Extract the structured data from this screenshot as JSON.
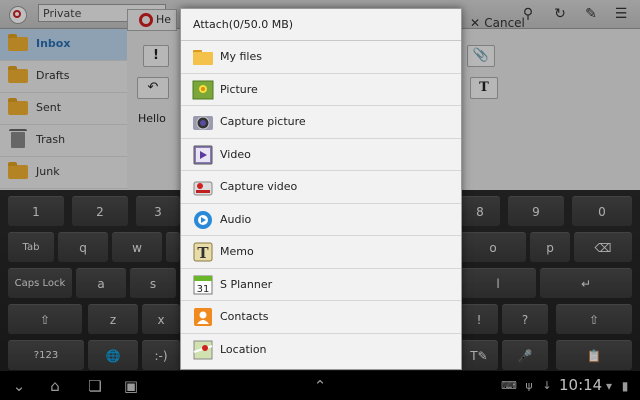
{
  "topbar": {
    "account_label": "Private",
    "compose_subject_prefix": "He",
    "cancel_label": "Cancel"
  },
  "folders": [
    {
      "label": "Inbox",
      "selected": true
    },
    {
      "label": "Drafts",
      "selected": false
    },
    {
      "label": "Sent",
      "selected": false
    },
    {
      "label": "Trash",
      "selected": false
    },
    {
      "label": "Junk",
      "selected": false
    }
  ],
  "compose": {
    "body_text": "Hello",
    "format_T": "T"
  },
  "keyboard": {
    "row1": [
      "1",
      "2",
      "3",
      "",
      "",
      "",
      "",
      "8",
      "9",
      "0"
    ],
    "row2": [
      "Tab",
      "q",
      "w",
      "",
      "",
      "",
      "",
      "o",
      "p",
      ""
    ],
    "row3": [
      "Caps Lock",
      "a",
      "s",
      "",
      "",
      "",
      "l",
      ""
    ],
    "row4": [
      "",
      "z",
      "x",
      "",
      "",
      "",
      "!",
      "?",
      ""
    ],
    "row5": [
      "?123",
      "",
      ":-)",
      "",
      "",
      "",
      ""
    ]
  },
  "dialog": {
    "title": "Attach(0/50.0 MB)",
    "items": [
      {
        "label": "My files",
        "icon": "folder-icon"
      },
      {
        "label": "Picture",
        "icon": "picture-icon"
      },
      {
        "label": "Capture picture",
        "icon": "camera-icon"
      },
      {
        "label": "Video",
        "icon": "video-icon"
      },
      {
        "label": "Capture video",
        "icon": "video-camera-icon"
      },
      {
        "label": "Audio",
        "icon": "audio-icon"
      },
      {
        "label": "Memo",
        "icon": "memo-icon"
      },
      {
        "label": "S Planner",
        "icon": "calendar-icon"
      },
      {
        "label": "Contacts",
        "icon": "contacts-icon"
      },
      {
        "label": "Location",
        "icon": "map-icon"
      }
    ],
    "calendar_day": "31"
  },
  "statusbar": {
    "time": "10:14"
  }
}
